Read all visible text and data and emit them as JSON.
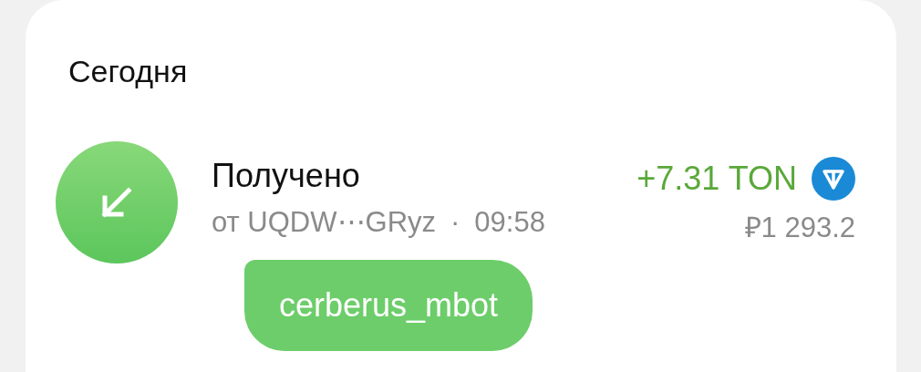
{
  "section_title": "Сегодня",
  "transactions": [
    {
      "kind": "received",
      "title": "Получено",
      "sender": "от UQDW⋯GRyz",
      "separator": "·",
      "time": "09:58",
      "amount": "+7.31 TON",
      "fiat": "₽1 293.2",
      "comment": "cerberus_mbot"
    }
  ]
}
